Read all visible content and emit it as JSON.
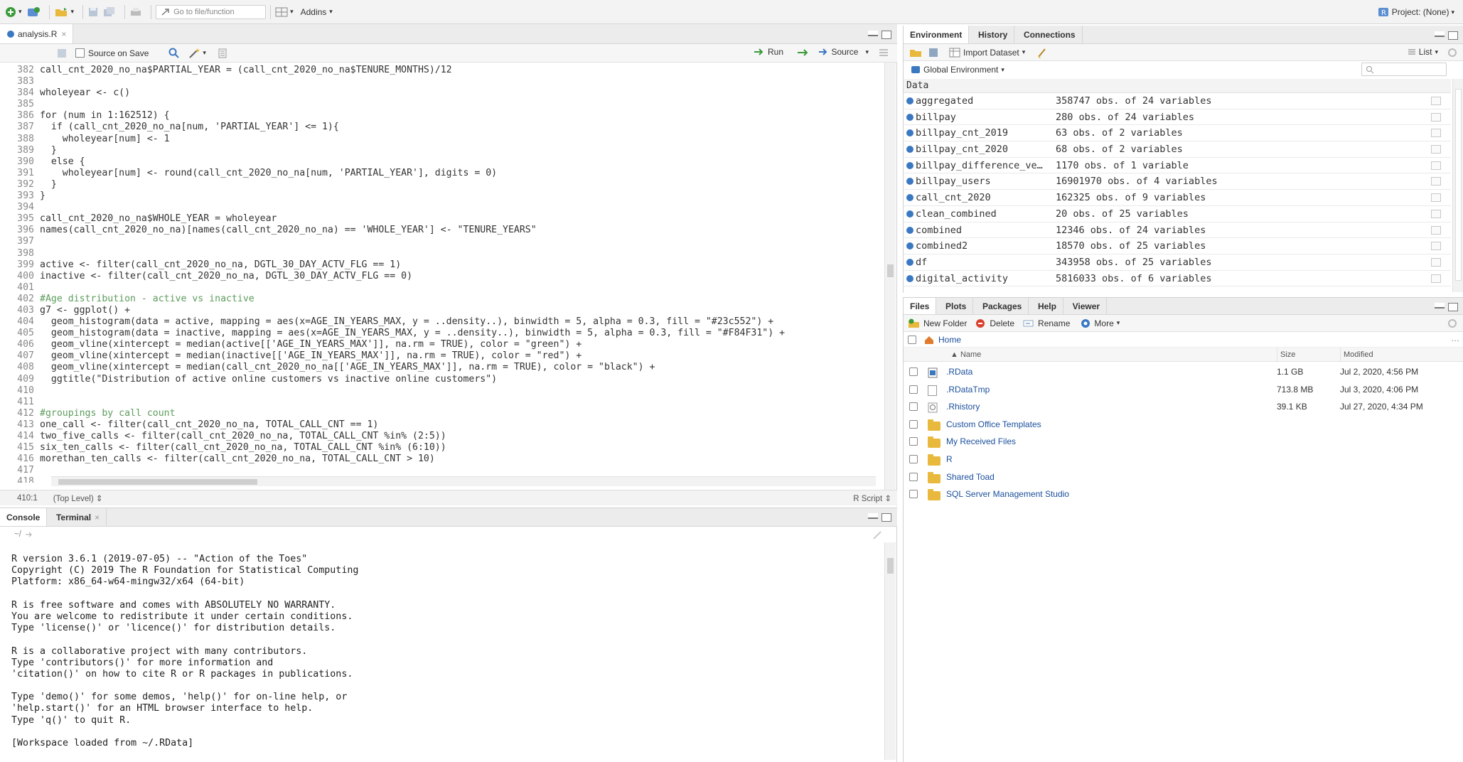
{
  "toolbar": {
    "goto_placeholder": "Go to file/function",
    "addins_label": "Addins",
    "project_label": "Project: (None)"
  },
  "editor": {
    "tab_label": "analysis.R",
    "source_on_save": "Source on Save",
    "run_label": "Run",
    "source_label": "Source",
    "status_pos": "410:1",
    "status_scope": "(Top Level)",
    "status_type": "R Script",
    "lines": [
      {
        "n": "382",
        "t": "call_cnt_2020_no_na$PARTIAL_YEAR = (call_cnt_2020_no_na$TENURE_MONTHS)/12"
      },
      {
        "n": "383",
        "t": ""
      },
      {
        "n": "384",
        "t": "wholeyear <- c()"
      },
      {
        "n": "385",
        "t": ""
      },
      {
        "n": "386",
        "t": "for (num in 1:162512) {"
      },
      {
        "n": "387",
        "t": "  if (call_cnt_2020_no_na[num, 'PARTIAL_YEAR'] <= 1){"
      },
      {
        "n": "388",
        "t": "    wholeyear[num] <- 1"
      },
      {
        "n": "389",
        "t": "  }"
      },
      {
        "n": "390",
        "t": "  else {"
      },
      {
        "n": "391",
        "t": "    wholeyear[num] <- round(call_cnt_2020_no_na[num, 'PARTIAL_YEAR'], digits = 0)"
      },
      {
        "n": "392",
        "t": "  }"
      },
      {
        "n": "393",
        "t": "}"
      },
      {
        "n": "394",
        "t": ""
      },
      {
        "n": "395",
        "t": "call_cnt_2020_no_na$WHOLE_YEAR = wholeyear"
      },
      {
        "n": "396",
        "t": "names(call_cnt_2020_no_na)[names(call_cnt_2020_no_na) == 'WHOLE_YEAR'] <- \"TENURE_YEARS\""
      },
      {
        "n": "397",
        "t": ""
      },
      {
        "n": "398",
        "t": ""
      },
      {
        "n": "399",
        "t": "active <- filter(call_cnt_2020_no_na, DGTL_30_DAY_ACTV_FLG == 1)"
      },
      {
        "n": "400",
        "t": "inactive <- filter(call_cnt_2020_no_na, DGTL_30_DAY_ACTV_FLG == 0)"
      },
      {
        "n": "401",
        "t": ""
      },
      {
        "n": "402",
        "t": "#Age distribution - active vs inactive"
      },
      {
        "n": "403",
        "t": "g7 <- ggplot() +"
      },
      {
        "n": "404",
        "t": "  geom_histogram(data = active, mapping = aes(x=AGE_IN_YEARS_MAX, y = ..density..), binwidth = 5, alpha = 0.3, fill = \"#23c552\") +"
      },
      {
        "n": "405",
        "t": "  geom_histogram(data = inactive, mapping = aes(x=AGE_IN_YEARS_MAX, y = ..density..), binwidth = 5, alpha = 0.3, fill = \"#F84F31\") +"
      },
      {
        "n": "406",
        "t": "  geom_vline(xintercept = median(active[['AGE_IN_YEARS_MAX']], na.rm = TRUE), color = \"green\") +"
      },
      {
        "n": "407",
        "t": "  geom_vline(xintercept = median(inactive[['AGE_IN_YEARS_MAX']], na.rm = TRUE), color = \"red\") +"
      },
      {
        "n": "408",
        "t": "  geom_vline(xintercept = median(call_cnt_2020_no_na[['AGE_IN_YEARS_MAX']], na.rm = TRUE), color = \"black\") +"
      },
      {
        "n": "409",
        "t": "  ggtitle(\"Distribution of active online customers vs inactive online customers\")"
      },
      {
        "n": "410",
        "t": ""
      },
      {
        "n": "411",
        "t": ""
      },
      {
        "n": "412",
        "t": "#groupings by call count"
      },
      {
        "n": "413",
        "t": "one_call <- filter(call_cnt_2020_no_na, TOTAL_CALL_CNT == 1)"
      },
      {
        "n": "414",
        "t": "two_five_calls <- filter(call_cnt_2020_no_na, TOTAL_CALL_CNT %in% (2:5))"
      },
      {
        "n": "415",
        "t": "six_ten_calls <- filter(call_cnt_2020_no_na, TOTAL_CALL_CNT %in% (6:10))"
      },
      {
        "n": "416",
        "t": "morethan_ten_calls <- filter(call_cnt_2020_no_na, TOTAL_CALL_CNT > 10)"
      },
      {
        "n": "417",
        "t": ""
      },
      {
        "n": "418",
        "t": ""
      }
    ]
  },
  "console": {
    "tab_console": "Console",
    "tab_terminal": "Terminal",
    "path": "~/",
    "lines": [
      "R version 3.6.1 (2019-07-05) -- \"Action of the Toes\"",
      "Copyright (C) 2019 The R Foundation for Statistical Computing",
      "Platform: x86_64-w64-mingw32/x64 (64-bit)",
      "",
      "R is free software and comes with ABSOLUTELY NO WARRANTY.",
      "You are welcome to redistribute it under certain conditions.",
      "Type 'license()' or 'licence()' for distribution details.",
      "",
      "R is a collaborative project with many contributors.",
      "Type 'contributors()' for more information and",
      "'citation()' on how to cite R or R packages in publications.",
      "",
      "Type 'demo()' for some demos, 'help()' for on-line help, or",
      "'help.start()' for an HTML browser interface to help.",
      "Type 'q()' to quit R.",
      "",
      "[Workspace loaded from ~/.RData]"
    ]
  },
  "env": {
    "tabs": [
      "Environment",
      "History",
      "Connections"
    ],
    "import_label": "Import Dataset",
    "list_label": "List",
    "scope_label": "Global Environment",
    "section": "Data",
    "rows": [
      {
        "name": "aggregated",
        "value": "358747 obs. of 24 variables"
      },
      {
        "name": "billpay",
        "value": "280 obs. of 24 variables"
      },
      {
        "name": "billpay_cnt_2019",
        "value": "63 obs. of 2 variables"
      },
      {
        "name": "billpay_cnt_2020",
        "value": "68 obs. of 2 variables"
      },
      {
        "name": "billpay_difference_ve…",
        "value": "1170 obs. of 1 variable"
      },
      {
        "name": "billpay_users",
        "value": "16901970 obs. of 4 variables"
      },
      {
        "name": "call_cnt_2020",
        "value": "162325 obs. of 9 variables"
      },
      {
        "name": "clean_combined",
        "value": "20 obs. of 25 variables"
      },
      {
        "name": "combined",
        "value": "12346 obs. of 24 variables"
      },
      {
        "name": "combined2",
        "value": "18570 obs. of 25 variables"
      },
      {
        "name": "df",
        "value": "343958 obs. of 25 variables"
      },
      {
        "name": "digital_activity",
        "value": "5816033 obs. of 6 variables"
      }
    ]
  },
  "files": {
    "tabs": [
      "Files",
      "Plots",
      "Packages",
      "Help",
      "Viewer"
    ],
    "new_folder": "New Folder",
    "delete": "Delete",
    "rename": "Rename",
    "more": "More",
    "home": "Home",
    "col_name": "Name",
    "col_size": "Size",
    "col_modified": "Modified",
    "rows": [
      {
        "name": ".RData",
        "size": "1.1 GB",
        "modified": "Jul 2, 2020, 4:56 PM",
        "icon": "rdata-icon"
      },
      {
        "name": ".RDataTmp",
        "size": "713.8 MB",
        "modified": "Jul 3, 2020, 4:06 PM",
        "icon": "file-icon"
      },
      {
        "name": ".Rhistory",
        "size": "39.1 KB",
        "modified": "Jul 27, 2020, 4:34 PM",
        "icon": "history-icon"
      },
      {
        "name": "Custom Office Templates",
        "size": "",
        "modified": "",
        "icon": "folder-icon"
      },
      {
        "name": "My Received Files",
        "size": "",
        "modified": "",
        "icon": "folder-icon"
      },
      {
        "name": "R",
        "size": "",
        "modified": "",
        "icon": "folder-icon"
      },
      {
        "name": "Shared Toad",
        "size": "",
        "modified": "",
        "icon": "folder-icon"
      },
      {
        "name": "SQL Server Management Studio",
        "size": "",
        "modified": "",
        "icon": "folder-icon"
      }
    ]
  }
}
